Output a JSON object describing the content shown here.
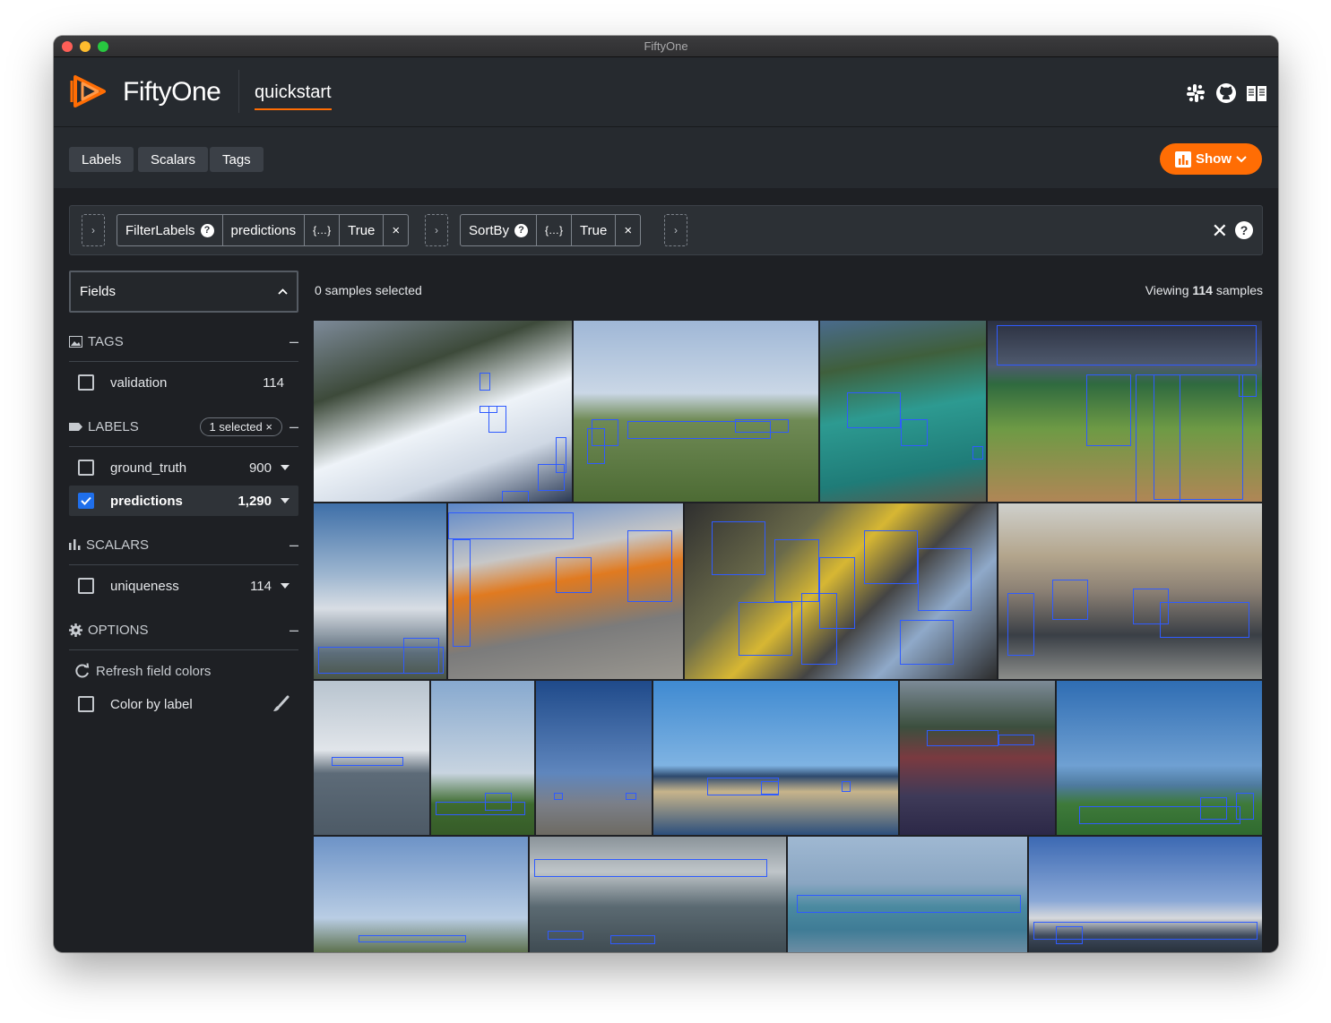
{
  "window": {
    "title": "FiftyOne"
  },
  "header": {
    "brand": "FiftyOne",
    "dataset": "quickstart",
    "icons": [
      "slack-icon",
      "github-icon",
      "docs-book-icon"
    ]
  },
  "subbar": {
    "tabs": [
      "Labels",
      "Scalars",
      "Tags"
    ],
    "show_label": "Show",
    "accent": "#ff6d04"
  },
  "view_bar": {
    "stages": [
      {
        "name": "FilterLabels",
        "field": "predictions",
        "expr": "{…}",
        "flag": "True"
      },
      {
        "name": "SortBy",
        "expr": "{…}",
        "flag": "True"
      }
    ]
  },
  "sidebar": {
    "fields_label": "Fields",
    "tags": {
      "title": "TAGS",
      "items": [
        {
          "name": "validation",
          "count": "114"
        }
      ]
    },
    "labels": {
      "title": "LABELS",
      "selected_pill": "1 selected ×",
      "items": [
        {
          "name": "ground_truth",
          "count": "900",
          "checked": false
        },
        {
          "name": "predictions",
          "count": "1,290",
          "checked": true
        }
      ]
    },
    "scalars": {
      "title": "SCALARS",
      "items": [
        {
          "name": "uniqueness",
          "count": "114"
        }
      ]
    },
    "options": {
      "title": "OPTIONS",
      "refresh": "Refresh field colors",
      "color_by": "Color by label"
    }
  },
  "grid": {
    "selected_text": "0 samples selected",
    "viewing_prefix": "Viewing",
    "viewing_count": "114",
    "viewing_suffix": "samples",
    "box_color": "#2f5bff"
  }
}
